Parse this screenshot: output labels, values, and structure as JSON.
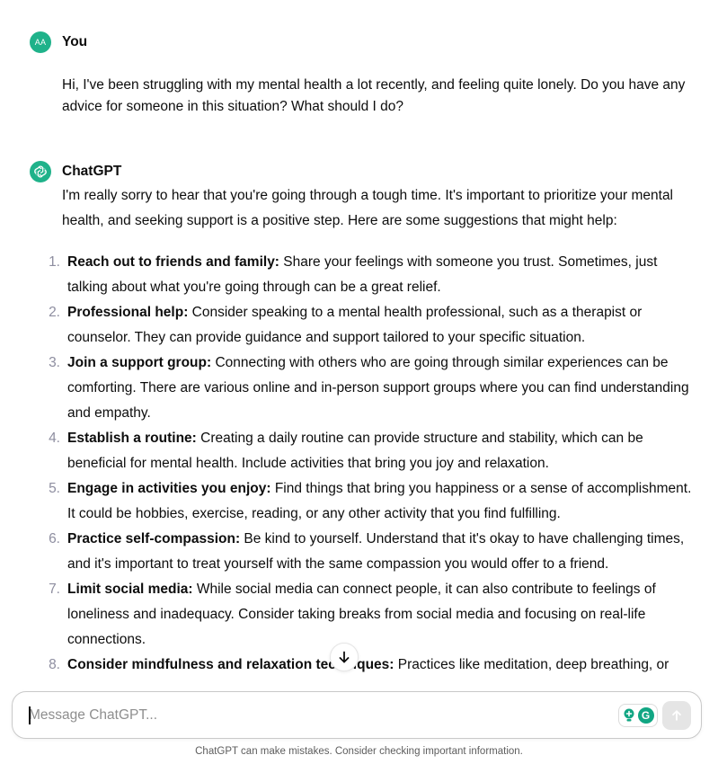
{
  "user_message": {
    "avatar_initials": "AA",
    "author": "You",
    "text": "Hi, I've been struggling with my mental health a lot recently, and feeling quite lonely. Do you have any advice for someone in this situation? What should I do?"
  },
  "assistant_message": {
    "author": "ChatGPT",
    "avatar_icon": "openai-logo-icon",
    "intro": "I'm really sorry to hear that you're going through a tough time. It's important to prioritize your mental health, and seeking support is a positive step. Here are some suggestions that might help:",
    "items": [
      {
        "num": "1.",
        "title": "Reach out to friends and family:",
        "text": " Share your feelings with someone you trust. Sometimes, just talking about what you're going through can be a great relief."
      },
      {
        "num": "2.",
        "title": "Professional help:",
        "text": " Consider speaking to a mental health professional, such as a therapist or counselor. They can provide guidance and support tailored to your specific situation."
      },
      {
        "num": "3.",
        "title": "Join a support group:",
        "text": " Connecting with others who are going through similar experiences can be comforting. There are various online and in-person support groups where you can find understanding and empathy."
      },
      {
        "num": "4.",
        "title": "Establish a routine:",
        "text": " Creating a daily routine can provide structure and stability, which can be beneficial for mental health. Include activities that bring you joy and relaxation."
      },
      {
        "num": "5.",
        "title": "Engage in activities you enjoy:",
        "text": " Find things that bring you happiness or a sense of accomplishment. It could be hobbies, exercise, reading, or any other activity that you find fulfilling."
      },
      {
        "num": "6.",
        "title": "Practice self-compassion:",
        "text": " Be kind to yourself. Understand that it's okay to have challenging times, and it's important to treat yourself with the same compassion you would offer to a friend."
      },
      {
        "num": "7.",
        "title": "Limit social media:",
        "text": " While social media can connect people, it can also contribute to feelings of loneliness and inadequacy. Consider taking breaks from social media and focusing on real-life connections."
      },
      {
        "num": "8.",
        "title": "Consider mindfulness and relaxation techniques:",
        "text": " Practices like meditation, deep breathing, or"
      }
    ]
  },
  "composer": {
    "placeholder": "Message ChatGPT...",
    "value": "",
    "extension_icons": [
      "grammarly-bulb-icon",
      "grammarly-logo-icon"
    ],
    "send_icon": "arrow-up-icon"
  },
  "scroll_button_icon": "arrow-down-icon",
  "disclaimer": "ChatGPT can make mistakes. Consider checking important information.",
  "colors": {
    "avatar": "#1fb28a",
    "grammarly": "#11a683",
    "send_disabled": "#e5e5e5"
  }
}
